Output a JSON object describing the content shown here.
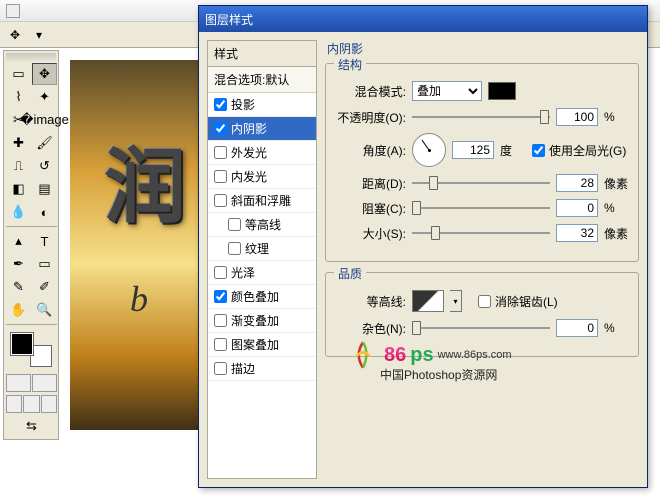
{
  "dialog": {
    "title": "图层样式",
    "styles_header": "样式",
    "blend_options": "混合选项:默认",
    "effects": [
      {
        "label": "投影",
        "checked": true,
        "sel": false
      },
      {
        "label": "内阴影",
        "checked": true,
        "sel": true
      },
      {
        "label": "外发光",
        "checked": false,
        "sel": false
      },
      {
        "label": "内发光",
        "checked": false,
        "sel": false
      },
      {
        "label": "斜面和浮雕",
        "checked": false,
        "sel": false
      },
      {
        "label": "等高线",
        "checked": false,
        "sel": false,
        "indent": true
      },
      {
        "label": "纹理",
        "checked": false,
        "sel": false,
        "indent": true
      },
      {
        "label": "光泽",
        "checked": false,
        "sel": false
      },
      {
        "label": "颜色叠加",
        "checked": true,
        "sel": false
      },
      {
        "label": "渐变叠加",
        "checked": false,
        "sel": false
      },
      {
        "label": "图案叠加",
        "checked": false,
        "sel": false
      },
      {
        "label": "描边",
        "checked": false,
        "sel": false
      }
    ],
    "panel_title": "内阴影",
    "structure": {
      "legend": "结构",
      "blend_mode_label": "混合模式:",
      "blend_mode_value": "叠加",
      "opacity_label": "不透明度(O):",
      "opacity_value": "100",
      "opacity_unit": "%",
      "angle_label": "角度(A):",
      "angle_value": "125",
      "angle_unit": "度",
      "global_light_label": "使用全局光(G)",
      "global_light_checked": true,
      "distance_label": "距离(D):",
      "distance_value": "28",
      "distance_unit": "像素",
      "choke_label": "阻塞(C):",
      "choke_value": "0",
      "choke_unit": "%",
      "size_label": "大小(S):",
      "size_value": "32",
      "size_unit": "像素"
    },
    "quality": {
      "legend": "品质",
      "contour_label": "等高线:",
      "antialias_label": "消除锯齿(L)",
      "antialias_checked": false,
      "noise_label": "杂色(N):",
      "noise_value": "0",
      "noise_unit": "%"
    }
  },
  "canvas": {
    "glyph": "润",
    "script_b": "b"
  },
  "watermark": {
    "brand1": "86",
    "brand2": "ps",
    "url": "www.86ps.com",
    "tagline": "中国Photoshop资源网"
  }
}
